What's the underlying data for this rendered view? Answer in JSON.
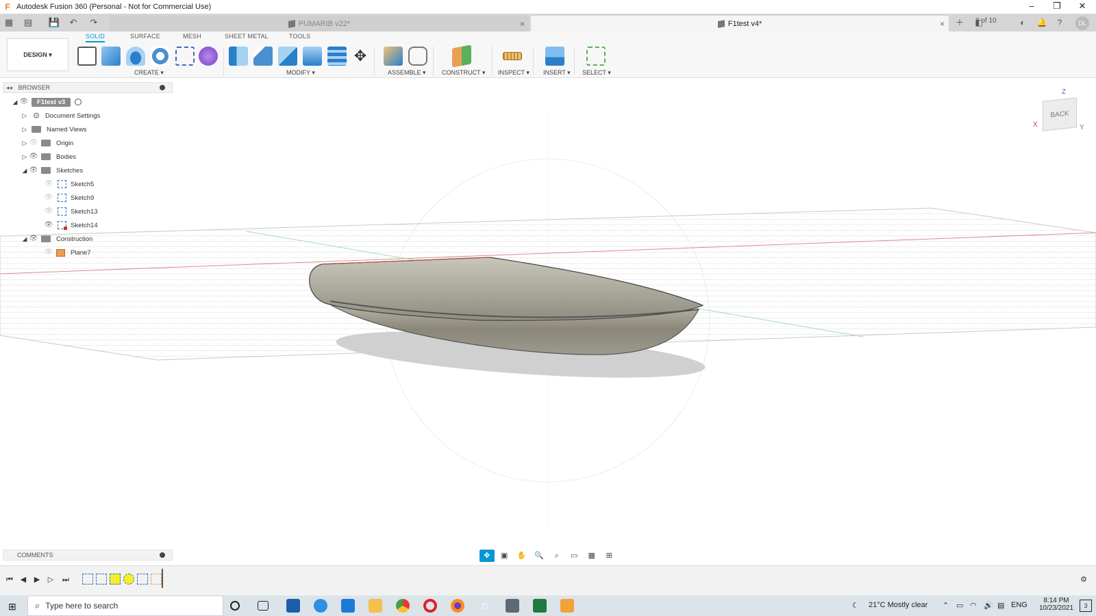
{
  "titlebar": {
    "title": "Autodesk Fusion 360 (Personal - Not for Commercial Use)",
    "app_icon": "F",
    "minimize": "–",
    "maximize": "❐",
    "close": "✕"
  },
  "tabs": {
    "inactive_label": "PUMARIB v22*",
    "active_label": "F1test v4*",
    "close_glyph": "×",
    "job_status": "8 of 10",
    "avatar": "DL"
  },
  "ribbon": {
    "workspace": "DESIGN ▾",
    "tabs": [
      "SOLID",
      "SURFACE",
      "MESH",
      "SHEET METAL",
      "TOOLS"
    ],
    "groups": {
      "create": "CREATE ▾",
      "modify": "MODIFY ▾",
      "assemble": "ASSEMBLE ▾",
      "construct": "CONSTRUCT ▾",
      "inspect": "INSPECT ▾",
      "insert": "INSERT ▾",
      "select": "SELECT ▾"
    }
  },
  "browser": {
    "header": "BROWSER",
    "collapse": "◂◂",
    "root": "F1test v3",
    "nodes": {
      "doc_settings": "Document Settings",
      "named_views": "Named Views",
      "origin": "Origin",
      "bodies": "Bodies",
      "sketches": "Sketches",
      "sketch5": "Sketch5",
      "sketch9": "Sketch9",
      "sketch13": "Sketch13",
      "sketch14": "Sketch14",
      "construction": "Construction",
      "plane7": "Plane7"
    }
  },
  "viewcube": {
    "face": "BACK",
    "z": "Z",
    "x": "X",
    "y": "Y"
  },
  "comments": {
    "label": "COMMENTS"
  },
  "taskbar": {
    "search_placeholder": "Type here to search",
    "weather": "21°C  Mostly clear",
    "lang": "ENG",
    "time": "8:14 PM",
    "date": "10/23/2021",
    "notifications": "3"
  }
}
